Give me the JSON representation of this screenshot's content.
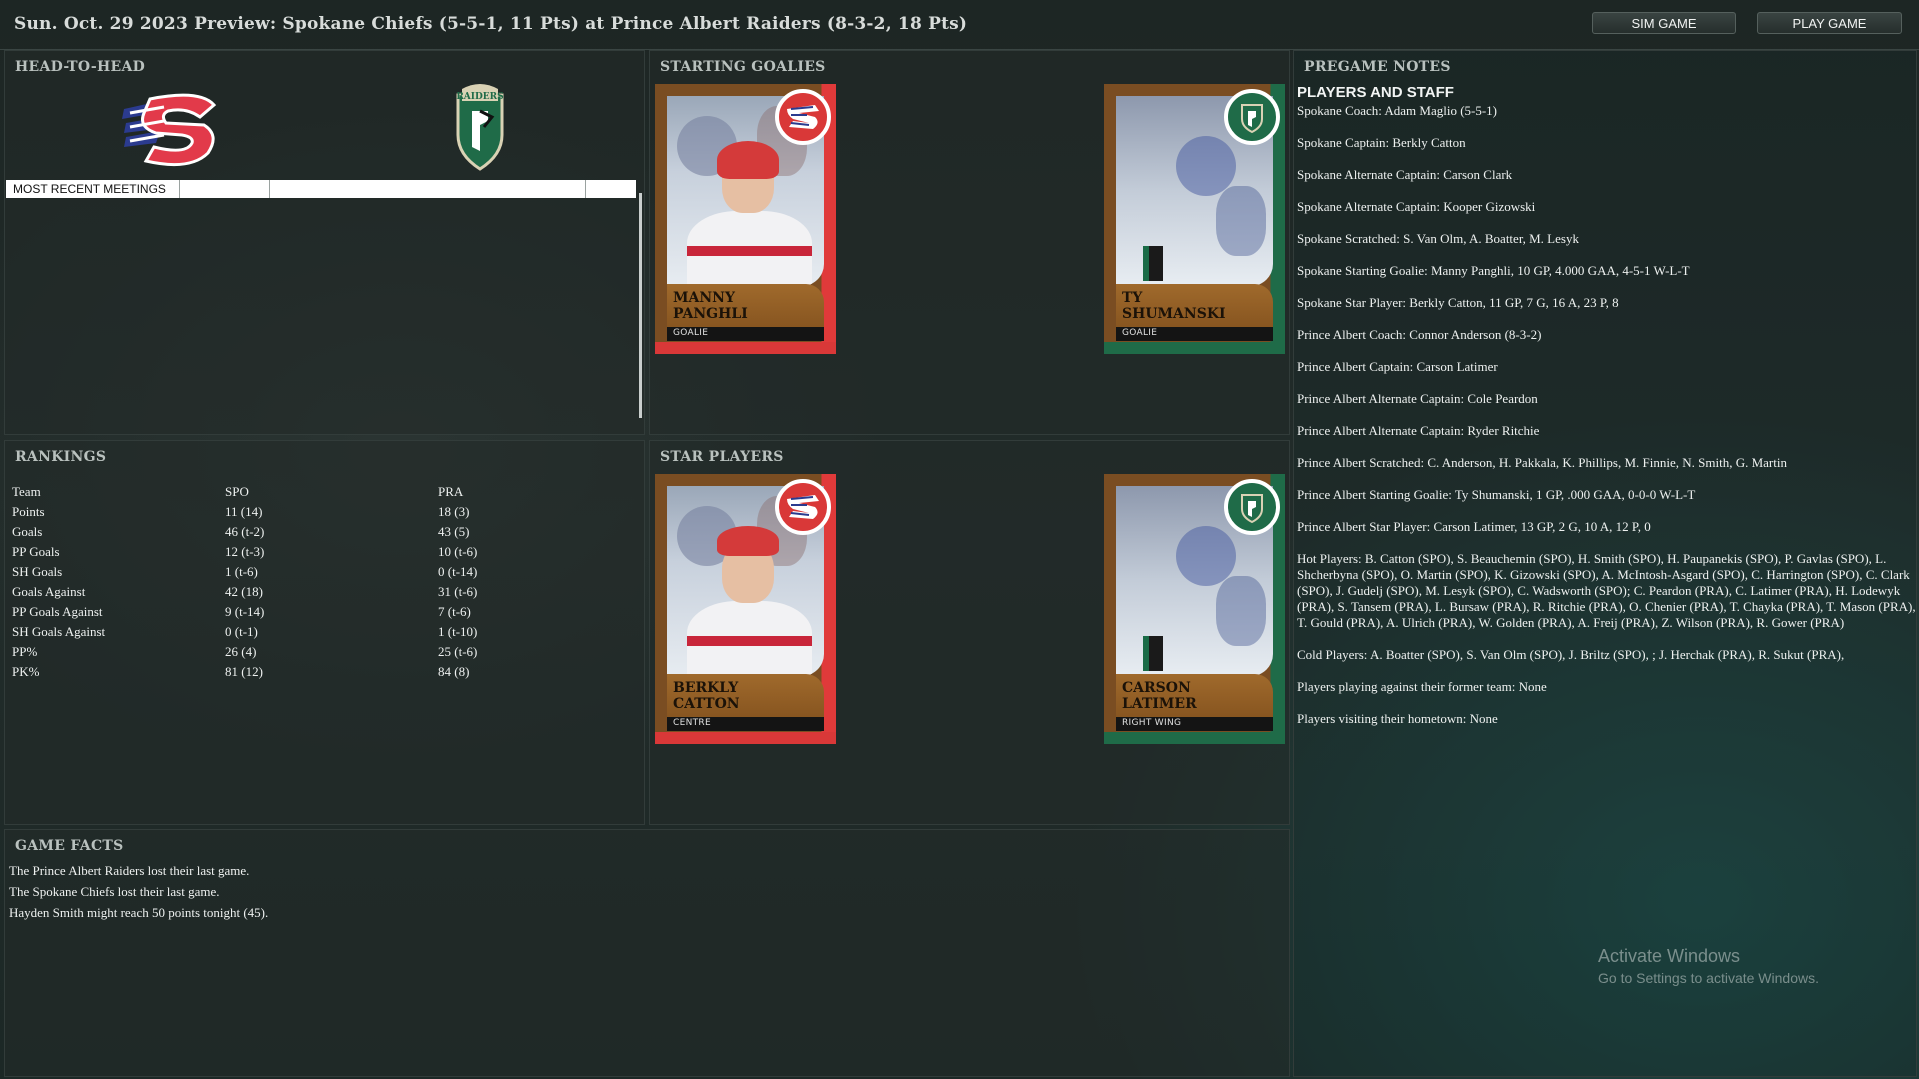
{
  "header": {
    "title": "Sun. Oct. 29 2023 Preview: Spokane Chiefs (5-5-1, 11 Pts) at Prince Albert Raiders (8-3-2, 18 Pts)",
    "sim_button": "SIM GAME",
    "play_button": "PLAY GAME"
  },
  "head_to_head": {
    "title": "HEAD-TO-HEAD",
    "home_logo": "spokane-chiefs-logo",
    "away_logo": "prince-albert-raiders-logo",
    "meetings_label": "MOST RECENT MEETINGS"
  },
  "rankings": {
    "title": "RANKINGS",
    "headers": [
      "Team",
      "SPO",
      "PRA"
    ],
    "rows": [
      [
        "Points",
        "11 (14)",
        "18 (3)"
      ],
      [
        "Goals",
        "46 (t-2)",
        "43 (5)"
      ],
      [
        "PP Goals",
        "12 (t-3)",
        "10 (t-6)"
      ],
      [
        "SH Goals",
        "1 (t-6)",
        "0 (t-14)"
      ],
      [
        "Goals Against",
        "42 (18)",
        "31 (t-6)"
      ],
      [
        "PP Goals Against",
        "9 (t-14)",
        "7 (t-6)"
      ],
      [
        "SH Goals Against",
        "0 (t-1)",
        "1 (t-10)"
      ],
      [
        "PP%",
        "26 (4)",
        "25 (t-6)"
      ],
      [
        "PK%",
        "81 (12)",
        "84 (8)"
      ]
    ]
  },
  "starting_goalies": {
    "title": "STARTING GOALIES",
    "cards": [
      {
        "name_line1": "MANNY",
        "name_line2": "PANGHLI",
        "position": "GOALIE",
        "team": "spokane"
      },
      {
        "name_line1": "TY",
        "name_line2": "SHUMANSKI",
        "position": "GOALIE",
        "team": "prince-albert"
      }
    ]
  },
  "star_players": {
    "title": "STAR PLAYERS",
    "cards": [
      {
        "name_line1": "BERKLY",
        "name_line2": "CATTON",
        "position": "CENTRE",
        "team": "spokane"
      },
      {
        "name_line1": "CARSON",
        "name_line2": "LATIMER",
        "position": "RIGHT WING",
        "team": "prince-albert"
      }
    ]
  },
  "pregame_notes": {
    "title": "PREGAME NOTES",
    "subtitle": "PLAYERS AND STAFF",
    "lines": [
      "Spokane Coach: Adam Maglio (5-5-1)",
      "Spokane Captain: Berkly Catton",
      "Spokane Alternate Captain: Carson Clark",
      "Spokane Alternate Captain: Kooper Gizowski",
      "Spokane Scratched: S. Van Olm, A. Boatter, M. Lesyk",
      "Spokane Starting Goalie: Manny Panghli, 10 GP, 4.000 GAA, 4-5-1 W-L-T",
      "Spokane Star Player: Berkly Catton, 11 GP, 7 G, 16 A, 23 P, 8",
      "Prince Albert Coach: Connor Anderson (8-3-2)",
      "Prince Albert Captain: Carson Latimer",
      "Prince Albert Alternate Captain: Cole Peardon",
      "Prince Albert Alternate Captain: Ryder Ritchie",
      "Prince Albert Scratched: C. Anderson, H. Pakkala, K. Phillips, M. Finnie, N. Smith, G. Martin",
      "Prince Albert Starting Goalie: Ty Shumanski, 1 GP, .000 GAA, 0-0-0 W-L-T",
      "Prince Albert Star Player: Carson Latimer, 13 GP, 2 G, 10 A, 12 P, 0",
      "Hot Players: B. Catton (SPO), S. Beauchemin (SPO), H. Smith (SPO), H. Paupanekis (SPO), P. Gavlas (SPO), L. Shcherbyna (SPO), O. Martin (SPO), K. Gizowski (SPO), A. McIntosh-Asgard (SPO), C. Harrington (SPO), C. Clark (SPO), J. Gudelj (SPO), M. Lesyk (SPO), C. Wadsworth (SPO); C. Peardon (PRA), C. Latimer (PRA), H. Lodewyk (PRA), S. Tansem (PRA), L. Bursaw (PRA), R. Ritchie (PRA), O. Chenier (PRA), T. Chayka (PRA), T. Mason (PRA), T. Gould (PRA), A. Ulrich (PRA), W. Golden (PRA), A. Freij (PRA), Z. Wilson (PRA), R. Gower (PRA)",
      "Cold Players: A. Boatter (SPO), S. Van Olm (SPO), J. Briltz (SPO), ; J. Herchak (PRA), R. Sukut (PRA),",
      "Players playing against their former team: None",
      "Players visiting their hometown: None"
    ]
  },
  "game_facts": {
    "title": "GAME FACTS",
    "lines": [
      "The Prince Albert Raiders  lost their last game.",
      "The Spokane Chiefs lost their last game.",
      "Hayden Smith might reach 50 points tonight (45)."
    ]
  },
  "watermark": {
    "line1": "Activate Windows",
    "line2": "Go to Settings to activate Windows."
  },
  "colors": {
    "spokane_red": "#d93838",
    "raiders_green": "#1f6b48",
    "card_gold": "#a06a2c"
  }
}
